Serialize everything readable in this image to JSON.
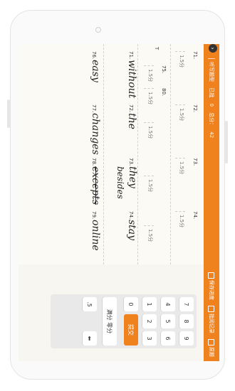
{
  "topbar": {
    "close": "✕",
    "title": "听写题型",
    "status": "已批",
    "count": "0",
    "total_label": "总分：",
    "total": "42",
    "actions": [
      {
        "label": "保存进度",
        "icon": "save-icon"
      },
      {
        "label": "批阅记录",
        "icon": "record-icon"
      },
      {
        "label": "原题",
        "icon": "original-icon"
      }
    ]
  },
  "rows": [
    {
      "items": [
        {
          "num": "71.",
          "score": "1.5分"
        },
        {
          "num": "72.",
          "score": "1.5分"
        },
        {
          "num": "73.",
          "score": "1.5分"
        },
        {
          "num": "74.",
          "score": "1.5分"
        }
      ]
    },
    {
      "items": [
        {
          "num": "75.",
          "score": "1.5分",
          "answer": "without"
        },
        {
          "num": "76.",
          "score": "1.5分",
          "answer": "easy"
        },
        {
          "num": "77.",
          "score": "1.5分",
          "answer": "changes"
        },
        {
          "num": "78.",
          "score": "1.5分",
          "answer": "excepts"
        },
        {
          "num": "79.",
          "score": "1.5分",
          "answer": "online"
        },
        {
          "num": "80.",
          "score": "1.5分"
        }
      ]
    },
    {
      "items": [
        {
          "num": "71.",
          "answer": "without"
        },
        {
          "num": "72.",
          "answer": "the"
        },
        {
          "num": "73.",
          "answer": "they"
        },
        {
          "num": "74.",
          "answer": "stay"
        }
      ]
    }
  ],
  "extras": {
    "besides": "besides",
    "tag": "T"
  },
  "keypad": {
    "keys": [
      "7",
      "8",
      "9",
      "4",
      "5",
      "6",
      "1",
      "2",
      "3",
      "0",
      ".5"
    ],
    "full": "满分",
    "zero": "零分",
    "submit": "提交",
    "back": "⬅"
  }
}
